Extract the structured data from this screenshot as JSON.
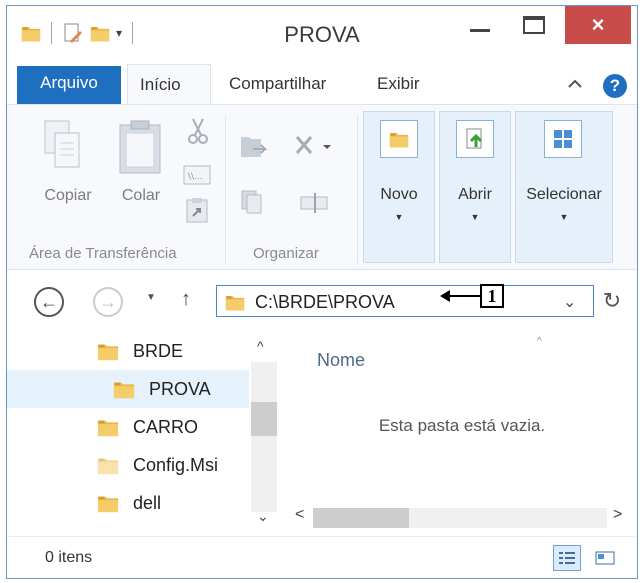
{
  "window": {
    "title": "PROVA",
    "close_symbol": "×"
  },
  "quick_access": {
    "dropdown_symbol": "▾"
  },
  "ribbon_tabs": {
    "arquivo": "Arquivo",
    "inicio": "Início",
    "compartilhar": "Compartilhar",
    "exibir": "Exibir",
    "help": "?"
  },
  "ribbon": {
    "copiar": "Copiar",
    "colar": "Colar",
    "area_transferencia": "Área de Transferência",
    "organizar": "Organizar",
    "novo": "Novo",
    "abrir": "Abrir",
    "selecionar": "Selecionar",
    "arrow": "▼"
  },
  "navigation": {
    "back": "←",
    "forward": "→",
    "recent": "▼",
    "up": "↑",
    "refresh": "↻"
  },
  "address_bar": {
    "path": "C:\\BRDE\\PROVA",
    "dropdown": "⌄"
  },
  "callout": {
    "number": "1"
  },
  "nav_pane": {
    "items": [
      {
        "label": "BRDE"
      },
      {
        "label": "PROVA"
      },
      {
        "label": "CARRO"
      },
      {
        "label": "Config.Msi"
      },
      {
        "label": "dell"
      }
    ],
    "scroll_up": "^",
    "scroll_down": "⌄"
  },
  "content": {
    "column_name": "Nome",
    "empty_message": "Esta pasta está vazia.",
    "sort_arrow": "^",
    "scroll_left": "<",
    "scroll_right": ">"
  },
  "status_bar": {
    "item_count": "0 itens"
  },
  "colors": {
    "accent": "#1e6fbf",
    "close": "#c74c4a",
    "folder": "#e8b84a"
  }
}
